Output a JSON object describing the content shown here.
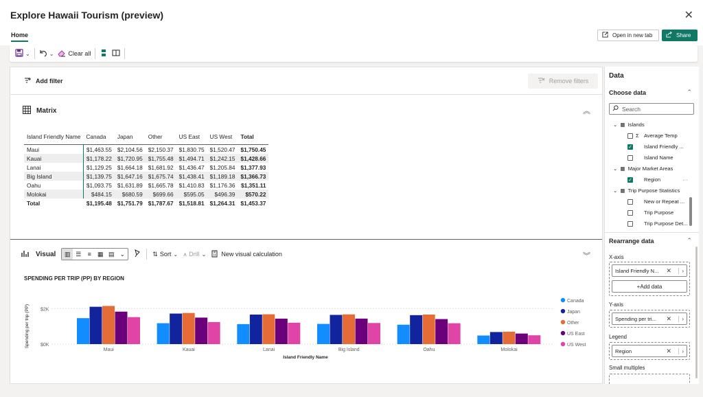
{
  "window": {
    "title": "Explore Hawaii Tourism (preview)"
  },
  "tabs": {
    "home": "Home"
  },
  "header_actions": {
    "open_new_tab": "Open in new tab",
    "share": "Share"
  },
  "toolbar": {
    "clear_all": "Clear all"
  },
  "filters": {
    "add_filter": "Add filter",
    "remove_filters": "Remove filters"
  },
  "matrix": {
    "title": "Matrix",
    "columns": [
      "Island Friendly Name",
      "Canada",
      "Japan",
      "Other",
      "US East",
      "US West",
      "Total"
    ],
    "rows": [
      [
        "Maui",
        "$1,463.55",
        "$2,104.56",
        "$2,150.37",
        "$1,830.75",
        "$1,520.47",
        "$1,750.45"
      ],
      [
        "Kauai",
        "$1,178.22",
        "$1,720.95",
        "$1,755.48",
        "$1,494.71",
        "$1,242.15",
        "$1,428.66"
      ],
      [
        "Lanai",
        "$1,129.25",
        "$1,664.18",
        "$1,681.92",
        "$1,436.47",
        "$1,205.84",
        "$1,377.93"
      ],
      [
        "Big Island",
        "$1,139.75",
        "$1,647.16",
        "$1,675.74",
        "$1,438.41",
        "$1,189.18",
        "$1,366.73"
      ],
      [
        "Oahu",
        "$1,093.75",
        "$1,631.89",
        "$1,665.78",
        "$1,410.83",
        "$1,176.36",
        "$1,351.11"
      ],
      [
        "Molokai",
        "$484.15",
        "$680.59",
        "$699.66",
        "$595.05",
        "$496.39",
        "$570.22"
      ]
    ],
    "total_row": [
      "Total",
      "$1,195.48",
      "$1,751.79",
      "$1,787.67",
      "$1,518.81",
      "$1,264.31",
      "$1,453.37"
    ]
  },
  "visual": {
    "title": "Visual",
    "sort": "Sort",
    "drill": "Drill",
    "new_calc": "New visual calculation"
  },
  "chart_data": {
    "type": "bar",
    "title": "SPENDING PER TRIP (PP) BY REGION",
    "xlabel": "Island Friendly Name",
    "ylabel": "Spending per trip (PP)",
    "y_ticks": [
      "$0K",
      "$2K"
    ],
    "ylim": [
      0,
      2400
    ],
    "grid": true,
    "legend_position": "right",
    "categories": [
      "Maui",
      "Kauai",
      "Lanai",
      "Big Island",
      "Oahu",
      "Molokai"
    ],
    "series": [
      {
        "name": "Canada",
        "color": "#118DFF",
        "values": [
          1463.55,
          1178.22,
          1129.25,
          1139.75,
          1093.75,
          484.15
        ]
      },
      {
        "name": "Japan",
        "color": "#12239E",
        "values": [
          2104.56,
          1720.95,
          1664.18,
          1647.16,
          1631.89,
          680.59
        ]
      },
      {
        "name": "Other",
        "color": "#E66C37",
        "values": [
          2150.37,
          1755.48,
          1681.92,
          1675.74,
          1665.78,
          699.66
        ]
      },
      {
        "name": "US East",
        "color": "#6B007B",
        "values": [
          1830.75,
          1494.71,
          1436.47,
          1438.41,
          1410.83,
          595.05
        ]
      },
      {
        "name": "US West",
        "color": "#E044A7",
        "values": [
          1520.47,
          1242.15,
          1205.84,
          1189.18,
          1176.36,
          496.39
        ]
      }
    ]
  },
  "data_pane": {
    "title": "Data",
    "choose_data": "Choose data",
    "search_placeholder": "Search",
    "tables": [
      {
        "name": "Islands",
        "fields": [
          {
            "label": "Average Temp",
            "checked": false,
            "sigma": true
          },
          {
            "label": "Island Friendly ...",
            "checked": true,
            "sigma": false
          },
          {
            "label": "Island Name",
            "checked": false,
            "sigma": false
          }
        ]
      },
      {
        "name": "Major Market Areas",
        "fields": [
          {
            "label": "Region",
            "checked": true,
            "sigma": false
          }
        ]
      },
      {
        "name": "Trip Purpose Statistics",
        "fields": [
          {
            "label": "New or Repeat ...",
            "checked": false,
            "sigma": false
          },
          {
            "label": "Trip Purpose",
            "checked": false,
            "sigma": false
          },
          {
            "label": "Trip Purpose Det...",
            "checked": false,
            "sigma": false
          }
        ]
      }
    ],
    "rearrange": "Rearrange data",
    "x_axis_label": "X-axis",
    "x_axis_field": "Island Friendly N...",
    "add_data": "+Add data",
    "y_axis_label": "Y-axis",
    "y_axis_field": "Spending per tri...",
    "legend_label": "Legend",
    "legend_field": "Region",
    "small_multiples_label": "Small multiples"
  }
}
